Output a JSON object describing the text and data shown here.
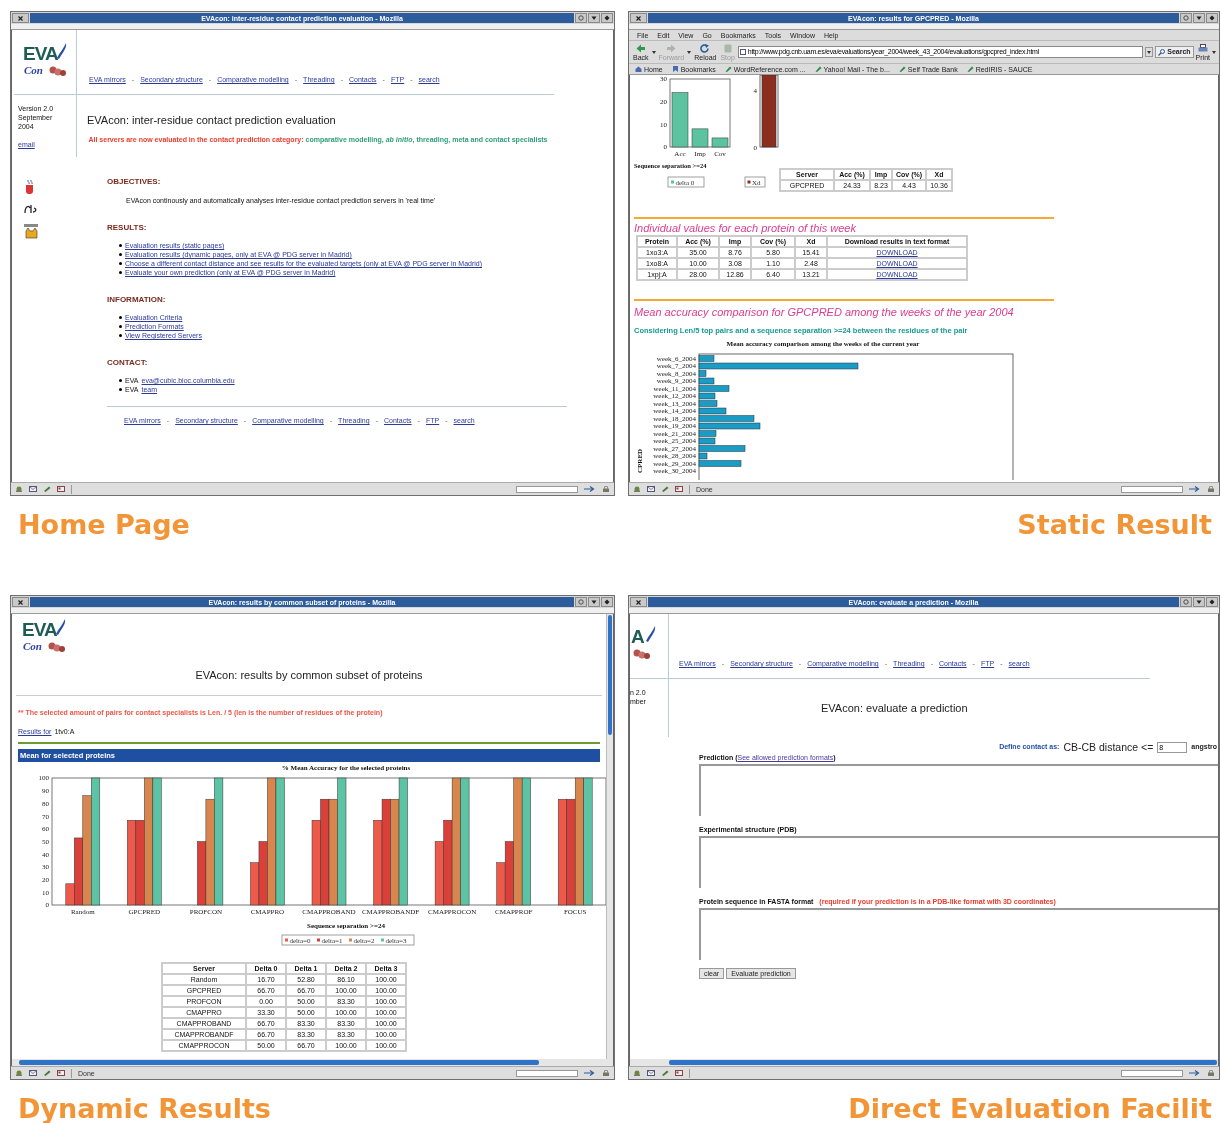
{
  "home_page": {
    "window_title": "EVAcon: inter-residue contact prediction evaluation - Mozilla",
    "progress": {
      "level": 0
    },
    "logo": {
      "main": "EVA",
      "sub": "Con"
    },
    "nav": [
      {
        "text": "EVA mirrors",
        "after": "-"
      },
      {
        "text": "Secondary structure",
        "after": "-"
      },
      {
        "text": "Comparative modelling",
        "after": "-"
      },
      {
        "text": "Threading",
        "after": "-"
      },
      {
        "text": "Contacts",
        "after": "-"
      },
      {
        "text": "FTP",
        "after": "-"
      },
      {
        "text": "search"
      }
    ],
    "version": "Version 2.0 September 2004",
    "email": "email",
    "heading": "EVAcon: inter-residue contact prediction evaluation",
    "notice": {
      "alert": "All servers are now evaluated in the contact prediction category:",
      "categories": "comparative modelling, *ab initio*, threading, meta and contact specialists"
    },
    "sections": [
      {
        "kind": "text",
        "heading": "OBJECTIVES:",
        "text": "EVAcon continously and automatically analyses inter-residue contact prediction servers in 'real time'"
      },
      {
        "kind": "links",
        "heading": "RESULTS:",
        "items": [
          "Evaluation results (static pages)",
          "Evaluation results (dynamic pages, only at EVA @ PDG server in Madrid)",
          "Choose a different contact distance and see results for the evaluated targets (only at EVA @ PDG server in Madrid)",
          "Evaluate your own prediction (only at EVA @ PDG server in Madrid)"
        ]
      },
      {
        "kind": "links",
        "heading": "INFORMATION:",
        "items": [
          "Evaluation Criteria",
          "Prediction Formats",
          "View Registered Servers"
        ]
      },
      {
        "kind": "contacts",
        "heading": "CONTACT:",
        "items": [
          {
            "prefix": "EVA",
            "link": "eva@cubic.bioc.columbia.edu"
          },
          {
            "prefix": "EVA",
            "link": "team"
          }
        ]
      }
    ],
    "footer_nav": [
      {
        "text": "EVA mirrors",
        "after": "-"
      },
      {
        "text": "Secondary structure",
        "after": "-"
      },
      {
        "text": "Comparative modelling",
        "after": "-"
      },
      {
        "text": "Threading",
        "after": "-"
      },
      {
        "text": "Contacts",
        "after": "-"
      },
      {
        "text": "FTP",
        "after": "-"
      },
      {
        "text": "search"
      }
    ],
    "caption": "Home Page"
  },
  "static_results": {
    "window_title": "EVAcon: results for GPCPRED - Mozilla",
    "progress": {
      "level": 0
    },
    "menu": [
      "File",
      "Edit",
      "View",
      "Go",
      "Bookmarks",
      "Tools",
      "Window",
      "Help"
    ],
    "toolbar": [
      {
        "kind": "back",
        "label": "Back",
        "disabled": false
      },
      {
        "kind": "forward",
        "label": "Forward",
        "disabled": true
      },
      {
        "kind": "reload",
        "label": "Reload",
        "disabled": false
      },
      {
        "kind": "stop",
        "label": "Stop",
        "disabled": true
      }
    ],
    "url": "http://www.pdg.cnb.uam.es/eva/evaluations/year_2004/week_43_2004/evaluations/gpcpred_index.html",
    "search_button": "Search",
    "print_button": "Print",
    "bookmarks": [
      {
        "kind": "home",
        "label": "Home"
      },
      {
        "kind": "folder",
        "label": "Bookmarks"
      },
      {
        "kind": "link",
        "label": "WordReference.com ..."
      },
      {
        "kind": "link",
        "label": "Yahoo! Mail - The b..."
      },
      {
        "kind": "link",
        "label": "Self Trade Bank"
      },
      {
        "kind": "link",
        "label": "RedIRIS - SAUCE"
      }
    ],
    "accuracy_chart": {
      "chart_data": {
        "type": "bar",
        "xlabel": "Sequence separation >=24",
        "categories": [
          "Acc",
          "Imp",
          "Cov"
        ],
        "series": [
          {
            "name": "delta 0",
            "color": "#5cc3a0",
            "values": [
              24,
              8,
              4
            ]
          }
        ],
        "ylim": [
          0,
          30
        ],
        "yticks": [
          0,
          10,
          20,
          30
        ],
        "legend": "bottom"
      }
    },
    "xd_chart": {
      "ticks": [
        "4",
        "0"
      ],
      "legend": "Xd"
    },
    "summary_table": {
      "columns": [
        "Server",
        "Acc (%)",
        "Imp",
        "Cov (%)",
        "Xd"
      ],
      "rows": [
        [
          "GPCPRED",
          "24.33",
          "8.23",
          "4.43",
          "10.36"
        ]
      ]
    },
    "protein_section": {
      "title": "Individual values for each protein of this week",
      "columns": [
        "Protein",
        "Acc (%)",
        "Imp",
        "Cov (%)",
        "Xd",
        "Download results in text format"
      ],
      "rows": [
        [
          "1xo3:A",
          "35.00",
          "8.76",
          "5.80",
          "15.41",
          "DOWNLOAD"
        ],
        [
          "1xo8:A",
          "10.00",
          "3.08",
          "1.10",
          "2.48",
          "DOWNLOAD"
        ],
        [
          "1xpj:A",
          "28.00",
          "12.86",
          "6.40",
          "13.21",
          "DOWNLOAD"
        ]
      ]
    },
    "weeks_section": {
      "title": "Mean accuracy comparison for GPCPRED among the weeks of the year 2004",
      "subtitle": "Considering Len/5 top pairs and a sequence separation >=24 between the residues of the pair",
      "chart_title": "Mean accuracy comparison among the weeks of the current year",
      "axis_label": "CPRED",
      "weeks": [
        "week_6_2004",
        "week_7_2004",
        "week_8_2004",
        "week_9_2004",
        "week_11_2004",
        "week_12_2004",
        "week_13_2004",
        "week_14_2004",
        "week_18_2004",
        "week_19_2004",
        "week_21_2004",
        "week_25_2004",
        "week_27_2004",
        "week_28_2004",
        "week_29_2004",
        "week_30_2004"
      ]
    },
    "status": "Done",
    "caption": "Static Result"
  },
  "dynamic_results": {
    "window_title": "EVAcon: results by common subset of proteins - Mozilla",
    "progress": {
      "level": 0
    },
    "logo": {
      "main": "EVA",
      "sub": "Con"
    },
    "heading": "EVAcon: results by common subset of proteins",
    "note": "** The selected amount of pairs for contact specialists is Len. / 5 (len is the number of residues of the protein)",
    "results_link": "Results for",
    "results_protein": "1tv0:A",
    "section_bar": "Mean for selected proteins",
    "chart_data": {
      "type": "bar",
      "title": "% Mean Accuracy for the selected proteins",
      "xlabel": "Sequence separation >=24",
      "categories": [
        "Random",
        "GPCPRED",
        "PROFCON",
        "CMAPPRO",
        "CMAPPROBAND",
        "CMAPPROBANDF",
        "CMAPPROCON",
        "CMAPPROF",
        "FOCUS"
      ],
      "series": [
        {
          "name": "delta=0",
          "color": "#ee5a4a",
          "values": [
            16.7,
            66.7,
            0,
            33.3,
            66.7,
            66.7,
            50,
            33.3,
            83.3
          ]
        },
        {
          "name": "delta=1",
          "color": "#d9403a",
          "values": [
            52.8,
            66.7,
            50,
            50,
            83.3,
            83.3,
            66.7,
            50,
            83.3
          ]
        },
        {
          "name": "delta=2",
          "color": "#d8864e",
          "values": [
            86.1,
            100,
            83.3,
            100,
            83.3,
            83.3,
            100,
            100,
            100
          ]
        },
        {
          "name": "delta=3",
          "color": "#5cc3a5",
          "values": [
            100,
            100,
            100,
            100,
            100,
            100,
            100,
            100,
            100
          ]
        }
      ],
      "ylim": [
        0,
        100
      ],
      "yticks": [
        0,
        10,
        20,
        30,
        40,
        50,
        60,
        70,
        80,
        90,
        100
      ],
      "legend": "bottom"
    },
    "table": {
      "columns": [
        "Server",
        "Delta 0",
        "Delta 1",
        "Delta 2",
        "Delta 3"
      ],
      "rows": [
        [
          "Random",
          "16.70",
          "52.80",
          "86.10",
          "100.00"
        ],
        [
          "GPCPRED",
          "66.70",
          "66.70",
          "100.00",
          "100.00"
        ],
        [
          "PROFCON",
          "0.00",
          "50.00",
          "83.30",
          "100.00"
        ],
        [
          "CMAPPRO",
          "33.30",
          "50.00",
          "100.00",
          "100.00"
        ],
        [
          "CMAPPROBAND",
          "66.70",
          "83.30",
          "83.30",
          "100.00"
        ],
        [
          "CMAPPROBANDF",
          "66.70",
          "83.30",
          "83.30",
          "100.00"
        ],
        [
          "CMAPPROCON",
          "50.00",
          "66.70",
          "100.00",
          "100.00"
        ]
      ]
    },
    "status": "Done",
    "caption": "Dynamic Results"
  },
  "direct_evaluation": {
    "window_title": "EVAcon: evaluate a prediction - Mozilla",
    "progress": {
      "level": 0
    },
    "logo_fragment": "A",
    "nav": [
      {
        "text": "EVA mirrors",
        "after": "-"
      },
      {
        "text": "Secondary structure",
        "after": "-"
      },
      {
        "text": "Comparative modelling",
        "after": "-"
      },
      {
        "text": "Threading",
        "after": "-"
      },
      {
        "text": "Contacts",
        "after": "-"
      },
      {
        "text": "FTP",
        "after": "-"
      },
      {
        "text": "search"
      }
    ],
    "version_fragment": [
      "n 2.0",
      "mber"
    ],
    "heading": "EVAcon: evaluate a prediction",
    "contact_definition": {
      "label": "Define contact as:",
      "measure": "CB-CB distance <=",
      "value": "8",
      "unit": "angstro"
    },
    "fields": [
      {
        "label": "Prediction (",
        "link": "See allowed prediction formats",
        "label_end": ")"
      },
      {
        "label": "Experimental structure (PDB)"
      },
      {
        "label": "Protein sequence in FASTA format",
        "note": "(required if your prediction is in a PDB-like format with 3D coordinates)"
      }
    ],
    "buttons": [
      "clear",
      "Evaluate prediction"
    ],
    "caption": "Direct Evaluation Facilit"
  }
}
